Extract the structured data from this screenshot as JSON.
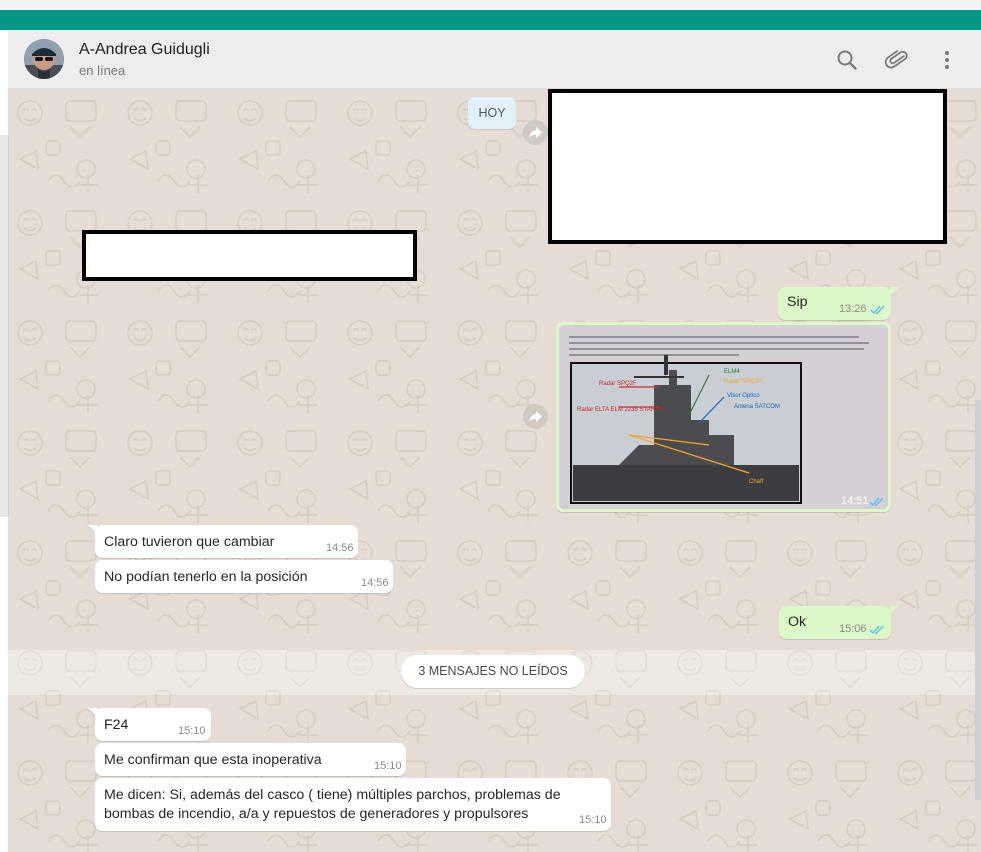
{
  "header": {
    "contact_name": "A-Andrea Guidugli",
    "status": "en línea",
    "icons": [
      "search-icon",
      "attach-icon",
      "menu-icon"
    ]
  },
  "date_chip": "HOY",
  "messages": [
    {
      "dir": "out",
      "text": "Sip",
      "time": "13:26",
      "ticks": "read"
    },
    {
      "dir": "out",
      "type": "image",
      "time": "14:51",
      "ticks": "read"
    },
    {
      "dir": "in",
      "text": "Claro tuvieron que cambiar",
      "time": "14:56"
    },
    {
      "dir": "in",
      "text": "No podían tenerlo en la posición",
      "time": "14:56"
    },
    {
      "dir": "out",
      "text": "Ok",
      "time": "15:06",
      "ticks": "read"
    },
    {
      "dir": "in",
      "text": "F24",
      "time": "15:10"
    },
    {
      "dir": "in",
      "text": "Me confirman que esta inoperativa",
      "time": "15:10"
    },
    {
      "dir": "in",
      "text_lines": [
        "Me dicen: Si, además del casco ( tiene) múltiples parchos, problemas de",
        "bombas de incendio, a/a y repuestos de generadores y propulsores"
      ],
      "time": "15:10"
    }
  ],
  "unread_banner": "3 MENSAJES NO LEÍDOS",
  "image_labels": {
    "radar1": "Radar SPQ2F",
    "radar2": "Radar ELTA ELM 2238 STAR 3D",
    "e1": "ELM4",
    "e2": "Radar SPQ2F",
    "e3": "Visor Optico",
    "e4": "Antena SATCOM",
    "e5": "Chaff"
  },
  "colors": {
    "teal": "#009688",
    "header_bg": "#ededed",
    "chat_bg": "#e5ddd5",
    "outgoing": "#dcf8c6",
    "incoming": "#ffffff",
    "read_ticks": "#4fc3f7"
  }
}
